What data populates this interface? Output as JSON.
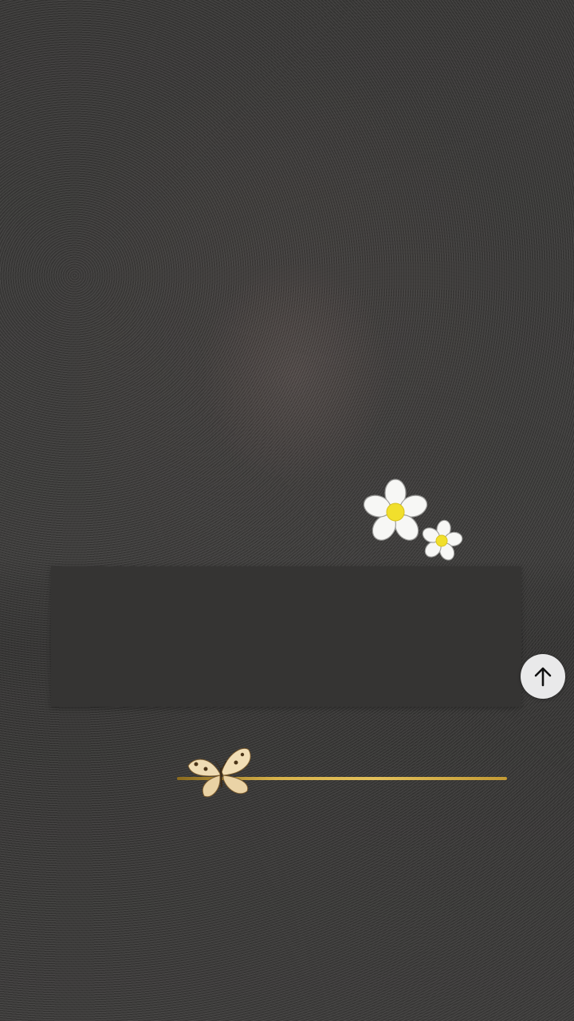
{
  "screen": {
    "background_color": "#3a3938",
    "card_color": "#353433",
    "accent_color": "#d8b24a"
  },
  "text_card": {
    "text": ""
  },
  "decorations": {
    "flowers_icon": "daisy-flowers-icon",
    "butterfly_icon": "butterfly-icon",
    "divider_color": "#d8b24a"
  },
  "scroll_top_button": {
    "icon": "arrow-up-icon",
    "background": "#e9e9ea"
  }
}
